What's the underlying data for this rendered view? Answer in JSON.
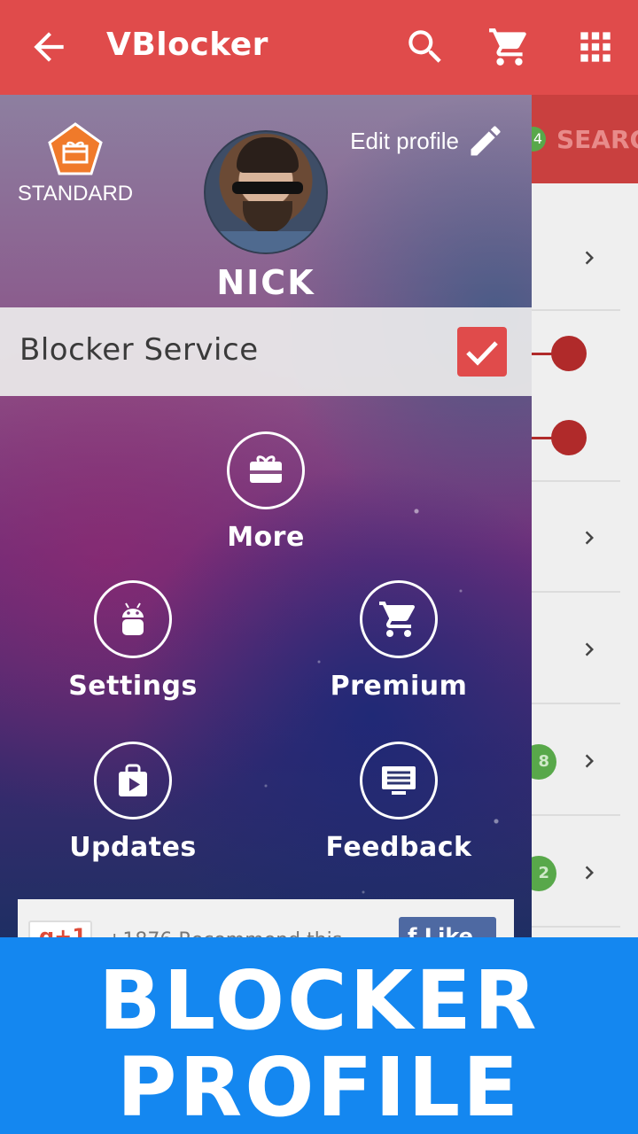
{
  "appbar": {
    "title": "VBlocker"
  },
  "drawer": {
    "tier": "STANDARD",
    "edit_profile": "Edit profile",
    "user_name": "NICK",
    "service": {
      "label": "Blocker Service",
      "checked": true
    },
    "menu": {
      "more": "More",
      "settings": "Settings",
      "premium": "Premium",
      "updates": "Updates",
      "feedback": "Feedback"
    }
  },
  "background": {
    "search_badge": "4",
    "search_label": "SEARC",
    "badge_a": "8",
    "badge_b": "2"
  },
  "banner": {
    "line1": "BLOCKER",
    "line2": "PROFILE"
  },
  "colors": {
    "primary": "#e04b4b",
    "banner": "#1487f0",
    "accent_green": "#58a84a"
  }
}
